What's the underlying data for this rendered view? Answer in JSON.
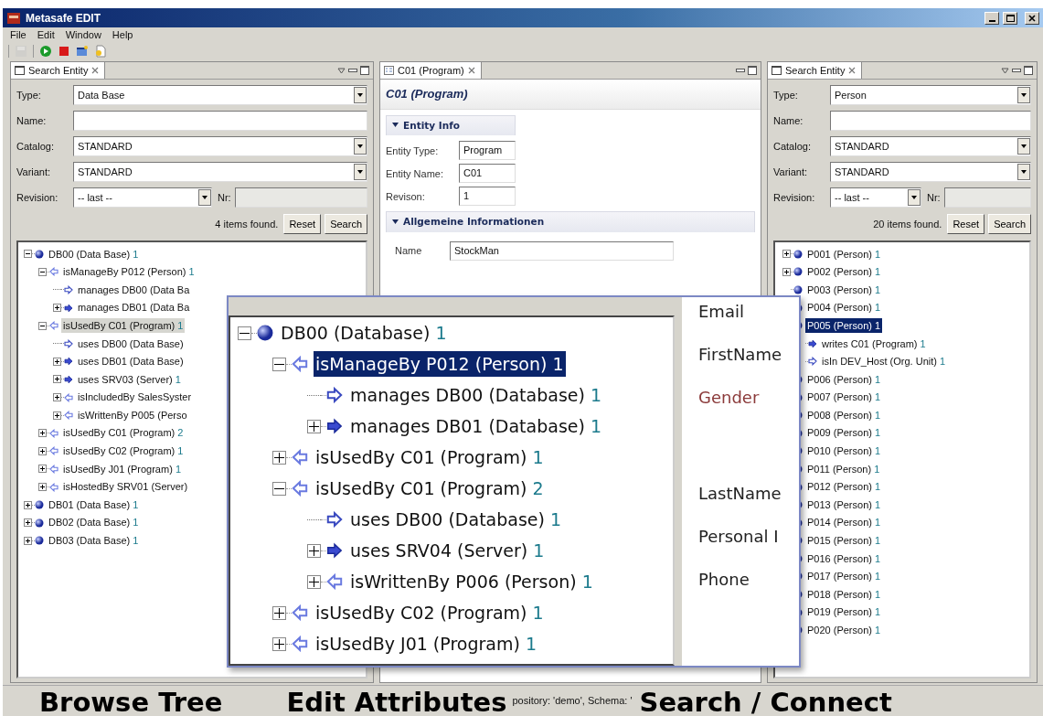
{
  "window": {
    "title": "Metasafe EDIT"
  },
  "menu": [
    "File",
    "Edit",
    "Window",
    "Help"
  ],
  "toolbar": [
    {
      "kind": "save",
      "disabled": true
    },
    {
      "kind": "run",
      "disabled": false
    },
    {
      "kind": "stop",
      "disabled": false
    },
    {
      "kind": "window",
      "disabled": false
    },
    {
      "kind": "new",
      "disabled": false
    }
  ],
  "left_panel": {
    "tab": "Search Entity",
    "fields": [
      {
        "label": "Type:",
        "kind": "select",
        "value": "Data Base"
      },
      {
        "label": "Name:",
        "kind": "input"
      },
      {
        "label": "Catalog:",
        "kind": "select",
        "value": "STANDARD"
      },
      {
        "label": "Variant:",
        "kind": "select",
        "value": "STANDARD"
      }
    ],
    "revision": {
      "label": "Revision:",
      "value": "-- last --",
      "nr_label": "Nr:"
    },
    "result": "4 items found.",
    "buttons": [
      "Reset",
      "Search"
    ],
    "tree_focused": false,
    "tree": [
      {
        "label": "DB00 (Data Base)",
        "count": "1",
        "kind": "entity",
        "expanded": true,
        "selected": false,
        "children": [
          {
            "label": "isManageBy P012 (Person)",
            "count": "1",
            "kind": "in",
            "expanded": true,
            "selected": false,
            "children": [
              {
                "label": "manages DB00 (Data Ba",
                "kind": "out",
                "leaf": true,
                "selected": false
              },
              {
                "label": "manages DB01 (Data Ba",
                "kind": "out-bold",
                "expanded": false,
                "selected": false
              }
            ]
          },
          {
            "label": "isUsedBy C01 (Program)",
            "count": "1",
            "kind": "in",
            "expanded": true,
            "selected": true,
            "children": [
              {
                "label": "uses DB00 (Data Base)",
                "kind": "out",
                "leaf": true,
                "selected": false
              },
              {
                "label": "uses DB01 (Data Base)",
                "kind": "out-bold",
                "expanded": false,
                "selected": false
              },
              {
                "label": "uses SRV03 (Server)",
                "count": "1",
                "kind": "out-bold",
                "expanded": false,
                "selected": false
              },
              {
                "label": "isIncludedBy SalesSyster",
                "kind": "in",
                "expanded": false,
                "selected": false
              },
              {
                "label": "isWrittenBy P005 (Perso",
                "kind": "in",
                "expanded": false,
                "selected": false
              }
            ]
          },
          {
            "label": "isUsedBy C01 (Program)",
            "count": "2",
            "kind": "in",
            "expanded": false,
            "selected": false
          },
          {
            "label": "isUsedBy C02 (Program)",
            "count": "1",
            "kind": "in",
            "expanded": false,
            "selected": false
          },
          {
            "label": "isUsedBy J01 (Program)",
            "count": "1",
            "kind": "in",
            "expanded": false,
            "selected": false
          },
          {
            "label": "isHostedBy SRV01 (Server)",
            "kind": "in",
            "expanded": false,
            "selected": false
          }
        ]
      },
      {
        "label": "DB01 (Data Base)",
        "count": "1",
        "kind": "entity",
        "expanded": false,
        "selected": false
      },
      {
        "label": "DB02 (Data Base)",
        "count": "1",
        "kind": "entity",
        "expanded": false,
        "selected": false
      },
      {
        "label": "DB03 (Data Base)",
        "count": "1",
        "kind": "entity",
        "expanded": false,
        "selected": false
      }
    ]
  },
  "editor": {
    "tab": "C01 (Program)",
    "heading": "C01 (Program)",
    "sections": [
      {
        "title": "Entity Info",
        "expanded": true,
        "fields": [
          {
            "label": "Entity Type:",
            "value": "Program"
          },
          {
            "label": "Entity Name:",
            "value": "C01"
          },
          {
            "label": "Revison:",
            "value": "1"
          }
        ]
      },
      {
        "title": "Allgemeine Informationen",
        "expanded": true,
        "fields": [
          {
            "label": "Name",
            "value": "StockMan"
          }
        ]
      }
    ]
  },
  "right_panel": {
    "tab": "Search Entity",
    "fields": [
      {
        "label": "Type:",
        "kind": "select",
        "value": "Person"
      },
      {
        "label": "Name:",
        "kind": "input"
      },
      {
        "label": "Catalog:",
        "kind": "select",
        "value": "STANDARD"
      },
      {
        "label": "Variant:",
        "kind": "select",
        "value": "STANDARD"
      }
    ],
    "revision": {
      "label": "Revision:",
      "value": "-- last --",
      "nr_label": "Nr:"
    },
    "result": "20 items found.",
    "buttons": [
      "Reset",
      "Search"
    ],
    "tree_focused": true,
    "tree": [
      {
        "label": "P001 (Person)",
        "count": "1",
        "kind": "entity",
        "expanded": false,
        "selected": false
      },
      {
        "label": "P002 (Person)",
        "count": "1",
        "kind": "entity",
        "expanded": false,
        "selected": false
      },
      {
        "label": "P003 (Person)",
        "count": "1",
        "kind": "entity",
        "selected": false
      },
      {
        "label": "P004 (Person)",
        "count": "1",
        "kind": "entity",
        "selected": false
      },
      {
        "label": "P005 (Person)",
        "count": "1",
        "kind": "entity",
        "selected": true,
        "children": [
          {
            "label": "writes C01 (Program)",
            "count": "1",
            "kind": "out-bold",
            "selected": false
          },
          {
            "label": "isIn DEV_Host (Org. Unit)",
            "count": "1",
            "kind": "out",
            "selected": false
          }
        ]
      },
      {
        "label": "P006 (Person)",
        "count": "1",
        "kind": "entity",
        "selected": false
      },
      {
        "label": "P007 (Person)",
        "count": "1",
        "kind": "entity",
        "selected": false
      },
      {
        "label": "P008 (Person)",
        "count": "1",
        "kind": "entity",
        "selected": false
      },
      {
        "label": "P009 (Person)",
        "count": "1",
        "kind": "entity",
        "selected": false
      },
      {
        "label": "P010 (Person)",
        "count": "1",
        "kind": "entity",
        "selected": false
      },
      {
        "label": "P011 (Person)",
        "count": "1",
        "kind": "entity",
        "selected": false
      },
      {
        "label": "P012 (Person)",
        "count": "1",
        "kind": "entity",
        "selected": false
      },
      {
        "label": "P013 (Person)",
        "count": "1",
        "kind": "entity",
        "selected": false
      },
      {
        "label": "P014 (Person)",
        "count": "1",
        "kind": "entity",
        "selected": false
      },
      {
        "label": "P015 (Person)",
        "count": "1",
        "kind": "entity",
        "selected": false
      },
      {
        "label": "P016 (Person)",
        "count": "1",
        "kind": "entity",
        "selected": false
      },
      {
        "label": "P017 (Person)",
        "count": "1",
        "kind": "entity",
        "selected": false
      },
      {
        "label": "P018 (Person)",
        "count": "1",
        "kind": "entity",
        "selected": false
      },
      {
        "label": "P019 (Person)",
        "count": "1",
        "kind": "entity",
        "selected": false
      },
      {
        "label": "P020 (Person)",
        "count": "1",
        "kind": "entity",
        "selected": false
      }
    ]
  },
  "zoom_inset": {
    "tree_focused": true,
    "tree": [
      {
        "label": "DB00 (Database)",
        "count": "1",
        "kind": "entity",
        "expanded": true,
        "selected": false,
        "children": [
          {
            "label": "isManageBy P012 (Person)",
            "count": "1",
            "kind": "in",
            "expanded": true,
            "selected": true,
            "children": [
              {
                "label": "manages DB00 (Database)",
                "count": "1",
                "kind": "out",
                "leaf": true,
                "selected": false
              },
              {
                "label": "manages DB01 (Database)",
                "count": "1",
                "kind": "out-bold",
                "expanded": false,
                "selected": false
              }
            ]
          },
          {
            "label": "isUsedBy C01 (Program)",
            "count": "1",
            "kind": "in",
            "expanded": false,
            "selected": false
          },
          {
            "label": "isUsedBy C01 (Program)",
            "count": "2",
            "kind": "in",
            "expanded": true,
            "selected": false,
            "children": [
              {
                "label": "uses DB00 (Database)",
                "count": "1",
                "kind": "out",
                "leaf": true,
                "selected": false
              },
              {
                "label": "uses SRV04 (Server)",
                "count": "1",
                "kind": "out-bold",
                "expanded": false,
                "selected": false
              },
              {
                "label": "isWrittenBy P006 (Person)",
                "count": "1",
                "kind": "in",
                "expanded": false,
                "selected": false
              }
            ]
          },
          {
            "label": "isUsedBy C02 (Program)",
            "count": "1",
            "kind": "in",
            "expanded": false,
            "selected": false
          },
          {
            "label": "isUsedBy J01 (Program)",
            "count": "1",
            "kind": "in",
            "expanded": false,
            "selected": false
          }
        ]
      }
    ],
    "attributes": [
      {
        "label": "Email",
        "color": "#222222"
      },
      {
        "label": "FirstName",
        "color": "#222222"
      },
      {
        "label": "Gender",
        "color": "#8b3a3a"
      },
      {
        "label": "LastName",
        "color": "#222222"
      },
      {
        "label": "Personal I",
        "color": "#222222"
      },
      {
        "label": "Phone",
        "color": "#222222"
      }
    ]
  },
  "status_bar": {
    "text": "pository: 'demo', Schema: '"
  },
  "captions": [
    "Browse Tree",
    "Edit Attributes",
    "Search / Connect"
  ]
}
